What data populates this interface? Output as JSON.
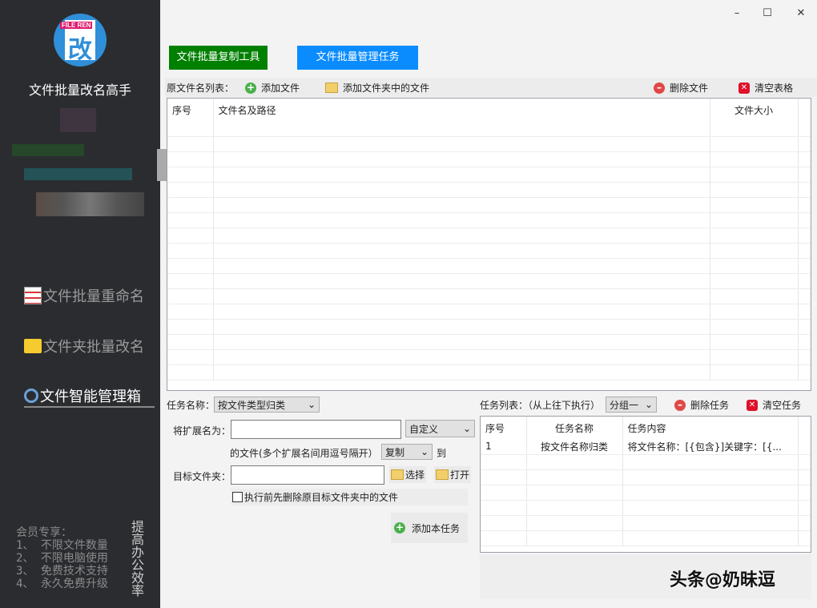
{
  "app": {
    "title": "文件批量改名高手",
    "logo_text": "FILE REN",
    "logo_char": "改"
  },
  "window": {
    "minimize": "–",
    "maximize": "☐",
    "close": "✕"
  },
  "sidebar": {
    "items": [
      {
        "label": "文件批量重命名",
        "icon": "document-list-icon"
      },
      {
        "label": "文件夹批量改名",
        "icon": "folder-icon"
      },
      {
        "label": "文件智能管理箱",
        "icon": "magnifier-icon",
        "active": true
      }
    ],
    "promo": [
      "会员专享：",
      "1、 不限文件数量",
      "2、 不限电脑使用",
      "3、 免费技术支持",
      "4、 永久免费升级"
    ],
    "slogan": "提高办公效率"
  },
  "tabs": [
    {
      "label": "文件批量复制工具",
      "color": "#008000"
    },
    {
      "label": "文件批量管理任务",
      "color": "#0a8cff"
    }
  ],
  "toolbar": {
    "label": "原文件名列表：",
    "add_file": "添加文件",
    "add_folder": "添加文件夹中的文件",
    "delete_file": "删除文件",
    "clear_table": "清空表格"
  },
  "file_table": {
    "columns": [
      "序号",
      "文件名及路径",
      "文件大小"
    ],
    "rows": []
  },
  "task_form": {
    "task_name_label": "任务名称：",
    "task_name_value": "按文件类型归类",
    "ext_label": "将扩展名为：",
    "ext_value": "",
    "ext_mode": "自定义",
    "note": "的文件(多个扩展名间用逗号隔开）",
    "action": "复制",
    "to": "到",
    "target_label": "目标文件夹：",
    "target_value": "",
    "choose": "选择",
    "open": "打开",
    "checkbox_label": "执行前先删除原目标文件夹中的文件",
    "add_task": "添加本任务"
  },
  "task_list": {
    "label": "任务列表：（从上往下执行）",
    "group": "分组一",
    "delete": "删除任务",
    "clear": "清空任务",
    "columns": [
      "序号",
      "任务名称",
      "任务内容"
    ],
    "rows": [
      [
        "1",
        "按文件名称归类",
        "将文件名称：[{包含}]关键字：[{..."
      ]
    ]
  },
  "watermark": "头条@奶昧逗"
}
